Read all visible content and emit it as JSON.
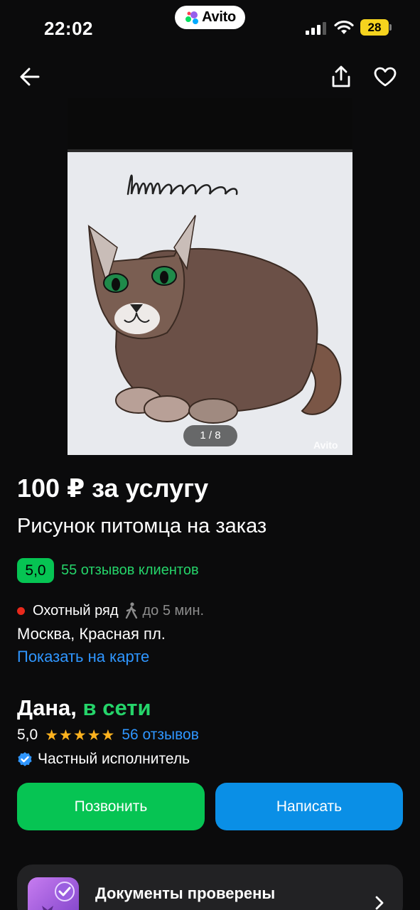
{
  "status_bar": {
    "time": "22:02",
    "app_badge": "Avito",
    "battery": "28"
  },
  "nav": {
    "back_icon": "back-arrow-icon",
    "share_icon": "share-icon",
    "favorite_icon": "heart-icon"
  },
  "gallery": {
    "counter": "1 / 8",
    "watermark": "Avito",
    "photo_caption": "Шиша"
  },
  "listing": {
    "price": "100 ₽ за услугу",
    "title": "Рисунок питомца на заказ",
    "rating": "5,0",
    "reviews": "55 отзывов клиентов"
  },
  "location": {
    "metro": "Охотный ряд",
    "walk_time": "до 5 мин.",
    "address": "Москва, Красная пл.",
    "map_link": "Показать на карте",
    "metro_color": "#e8291c"
  },
  "seller": {
    "name": "Дана,",
    "status": "в сети",
    "score": "5,0",
    "stars": 5,
    "reviews": "56 отзывов",
    "type": "Частный исполнитель"
  },
  "actions": {
    "call": "Позвонить",
    "write": "Написать"
  },
  "docs_card": {
    "title": "Документы проверены"
  },
  "colors": {
    "green": "#06c453",
    "blue": "#0a8fe6",
    "link_blue": "#2f96ff",
    "star": "#ffb21e"
  }
}
